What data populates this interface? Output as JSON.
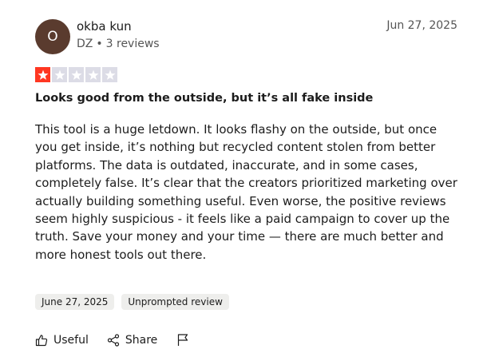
{
  "reviewer": {
    "initial": "O",
    "name": "okba kun",
    "country": "DZ",
    "reviews_count": "3 reviews"
  },
  "review": {
    "date": "Jun 27, 2025",
    "rating": 1,
    "max_rating": 5,
    "title": "Looks good from the outside, but it’s all fake inside",
    "body": "This tool is a huge letdown. It looks flashy on the outside, but once you get inside, it’s nothing but recycled content stolen from better platforms. The data is outdated, inaccurate, and in some cases, completely false. It’s clear that the creators prioritized marketing over actually building something useful. Even worse, the positive reviews seem highly suspicious - it feels like a paid campaign to cover up the truth. Save your money and your time — there are much better and more honest tools out there."
  },
  "tags": {
    "experience_date": "June 27, 2025",
    "prompt_type": "Unprompted review"
  },
  "actions": {
    "useful_label": "Useful",
    "share_label": "Share",
    "useful_icon": "thumbs-up-icon",
    "share_icon": "share-icon",
    "flag_icon": "flag-icon"
  },
  "colors": {
    "star_filled": "#ff3722",
    "star_empty": "#dcdce6",
    "avatar_bg": "#5a3b2e"
  }
}
